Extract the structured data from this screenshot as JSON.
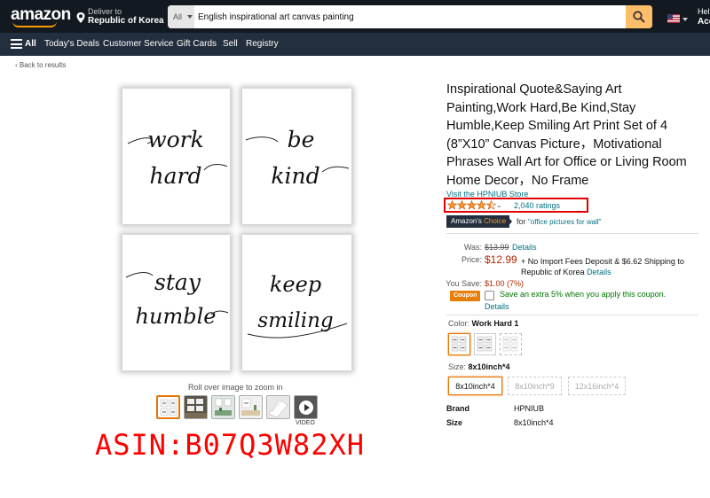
{
  "header": {
    "logo": "amazon",
    "deliver_line1": "Deliver to",
    "deliver_line2": "Republic of Korea",
    "search_dept": "All",
    "search_value": "English inspirational art canvas painting",
    "greeting": "Hell",
    "account": "Acc"
  },
  "subnav": {
    "all": "All",
    "items": [
      "Today's Deals",
      "Customer Service",
      "Gift Cards",
      "Sell",
      "Registry"
    ]
  },
  "back_link": "‹ Back to results",
  "gallery": {
    "canvases": [
      {
        "line1": "work",
        "line2": "hard"
      },
      {
        "line1": "be",
        "line2": "kind"
      },
      {
        "line1": "stay",
        "line2": "humble"
      },
      {
        "line1": "keep",
        "line2": "smiling"
      }
    ],
    "zoom_hint": "Roll over image to zoom in",
    "video_label": "VIDEO",
    "overlay_asin": "ASIN:B07Q3W82XH"
  },
  "product": {
    "title": "Inspirational Quote&Saying Art Painting,Work Hard,Be Kind,Stay Humble,Keep Smiling Art Print Set of 4 (8”X10” Canvas Picture，Motivational Phrases Wall Art for Office or Living Room Home Decor，No Frame",
    "store_link": "Visit the HPNIUB Store",
    "rating_stars": 4.5,
    "ratings_count": "2,040 ratings",
    "badge_main": "Amazon's",
    "badge_accent": "Choice",
    "badge_for": "for",
    "badge_keyword": "\"office pictures for wall\"",
    "was_label": "Was:",
    "was_price": "$13.99",
    "details": "Details",
    "price_label": "Price:",
    "price": "$12.99",
    "import_text": "+ No Import Fees Deposit & $6.62 Shipping to Republic of Korea",
    "import_details": "Details",
    "save_label": "You Save:",
    "save_value": "$1.00 (7%)",
    "coupon_badge": "Coupon",
    "coupon_text": "Save an extra 5% when you apply this coupon.",
    "coupon_details": "Details",
    "color_label": "Color:",
    "color_value": "Work Hard 1",
    "size_label": "Size:",
    "size_value": "8x10inch*4",
    "sizes": [
      "8x10inch*4",
      "8x10inch*9",
      "12x16inch*4"
    ],
    "specs": [
      {
        "key": "Brand",
        "value": "HPNIUB"
      },
      {
        "key": "Size",
        "value": "8x10inch*4"
      }
    ]
  },
  "colors": {
    "nav_bg": "#131921",
    "subnav_bg": "#232F3E",
    "search_button": "#FEBD69",
    "link": "#007185",
    "price_red": "#B12704",
    "highlight_box": "#E30000",
    "overlay_text": "#FF0000"
  },
  "icons": [
    "location-pin-icon",
    "search-icon",
    "us-flag-icon",
    "hamburger-menu-icon",
    "star-icon",
    "play-icon",
    "checkbox-icon"
  ]
}
